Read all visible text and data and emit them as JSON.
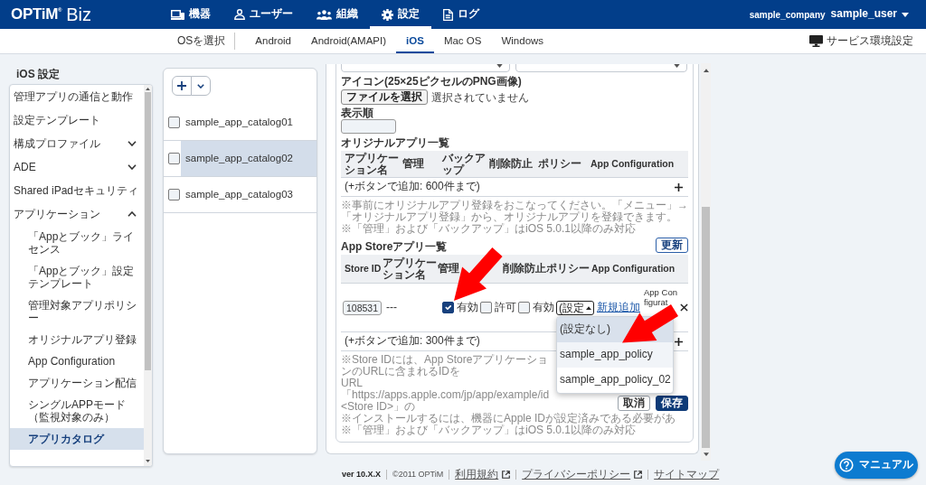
{
  "header": {
    "logo": "OPTiM$^{®}$",
    "product": "Biz",
    "nav": [
      {
        "label": "機器",
        "selected": false
      },
      {
        "label": "ユーザー",
        "selected": false
      },
      {
        "label": "組織",
        "selected": false
      },
      {
        "label": "設定",
        "selected": true
      },
      {
        "label": "ログ",
        "selected": false
      }
    ],
    "company": "sample_company",
    "user": "sample_user"
  },
  "os_bar": {
    "label": "OSを選択",
    "tabs": [
      {
        "label": "Android",
        "selected": false
      },
      {
        "label": "Android(AMAPI)",
        "selected": false
      },
      {
        "label": "iOS",
        "selected": true
      },
      {
        "label": "Mac OS",
        "selected": false
      },
      {
        "label": "Windows",
        "selected": false
      }
    ],
    "service_settings": "サービス環境設定"
  },
  "sidebar": {
    "title": "iOS 設定",
    "items": [
      {
        "kind": "link",
        "label": "管理アプリの通信と動作",
        "selected": false
      },
      {
        "kind": "link",
        "label": "設定テンプレート",
        "selected": false
      },
      {
        "kind": "group",
        "label": "構成プロファイル",
        "expanded": false
      },
      {
        "kind": "group",
        "label": "ADE",
        "expanded": false
      },
      {
        "kind": "link",
        "label": "Shared iPadセキュリティ",
        "selected": false
      },
      {
        "kind": "group",
        "label": "アプリケーション",
        "expanded": true,
        "children": [
          {
            "label": "「Appとブック」ライセンス",
            "selected": false
          },
          {
            "label": "「Appとブック」設定テンプレート",
            "selected": false
          },
          {
            "label": "管理対象アプリポリシー",
            "selected": false
          },
          {
            "label": "オリジナルアプリ登録",
            "selected": false
          },
          {
            "label": "App Configuration",
            "selected": false
          },
          {
            "label": "アプリケーション配信",
            "selected": false
          },
          {
            "label": "シングルAPPモード（監視対象のみ）",
            "selected": false
          },
          {
            "label": "アプリカタログ",
            "selected": true
          }
        ]
      }
    ]
  },
  "catalogs": {
    "items": [
      {
        "label": "sample_app_catalog01",
        "checked": false,
        "selected": false
      },
      {
        "label": "sample_app_catalog02",
        "checked": false,
        "selected": true
      },
      {
        "label": "sample_app_catalog03",
        "checked": false,
        "selected": false
      }
    ]
  },
  "detail": {
    "icon_label": "アイコン(25×25ピクセルのPNG画像)",
    "file_button": "ファイルを選択",
    "file_status": "選択されていません",
    "order_label": "表示順",
    "original_apps": {
      "title": "オリジナルアプリ一覧",
      "columns": [
        "アプリケーション名",
        "管理",
        "バックアップ",
        "削除防止",
        "ポリシー",
        "App Configuration"
      ],
      "add_hint": "(+ボタンで追加: 600件まで)",
      "notes": [
        "※事前にオリジナルアプリ登録をおこなってください。「メニュー」→「オリジナルアプリ登録」から、オリジナルアプリを登録できます。",
        "※「管理」および「バックアップ」はiOS 5.0.1以降のみ対応"
      ]
    },
    "store_apps": {
      "title": "App Storeアプリ一覧",
      "refresh": "更新",
      "columns": [
        "Store ID",
        "アプリケーション名",
        "管理",
        "削除防止",
        "ポリシー",
        "App Configuration"
      ],
      "rows": [
        {
          "store_id": "108531",
          "name": "---",
          "manage": {
            "label": "有効",
            "checked": true
          },
          "backup": {
            "label": "許可",
            "checked": false
          },
          "protect": {
            "label": "有効",
            "checked": false
          },
          "policy": {
            "value": "(設定",
            "expanded": true,
            "options": [
              {
                "label": "(設定なし)",
                "selected": true,
                "hovered": false
              },
              {
                "label": "sample_app_policy",
                "selected": false,
                "hovered": true
              },
              {
                "label": "sample_app_policy_02",
                "selected": false,
                "hovered": false
              }
            ]
          },
          "new_policy": "新規追加",
          "app_config": "App Configurat"
        }
      ],
      "add_hint": "(+ボタンで追加: 300件まで)",
      "notes": [
        "※Store IDには、App StoreアプリケーションのURLに含まれるIDを",
        "URL「https://apps.apple.com/jp/app/example/id<Store ID>」の",
        "※インストールするには、機器にApple IDが設定済みである必要があ",
        "※「管理」および「バックアップ」はiOS 5.0.1以降のみ対応"
      ]
    },
    "buttons": [
      {
        "label": "取消",
        "kind": "secondary"
      },
      {
        "label": "保存",
        "kind": "primary"
      }
    ]
  },
  "annotations": [
    {
      "kind": "arrow"
    },
    {
      "kind": "arrow"
    }
  ],
  "footer": {
    "version": "ver 10.X.X",
    "copyright": "©2011 OPTiM",
    "links": [
      {
        "label": "利用規約",
        "external": true
      },
      {
        "label": "プライバシーポリシー",
        "external": true
      },
      {
        "label": "サイトマップ",
        "external": false
      }
    ]
  },
  "manual_button": "マニュアル"
}
